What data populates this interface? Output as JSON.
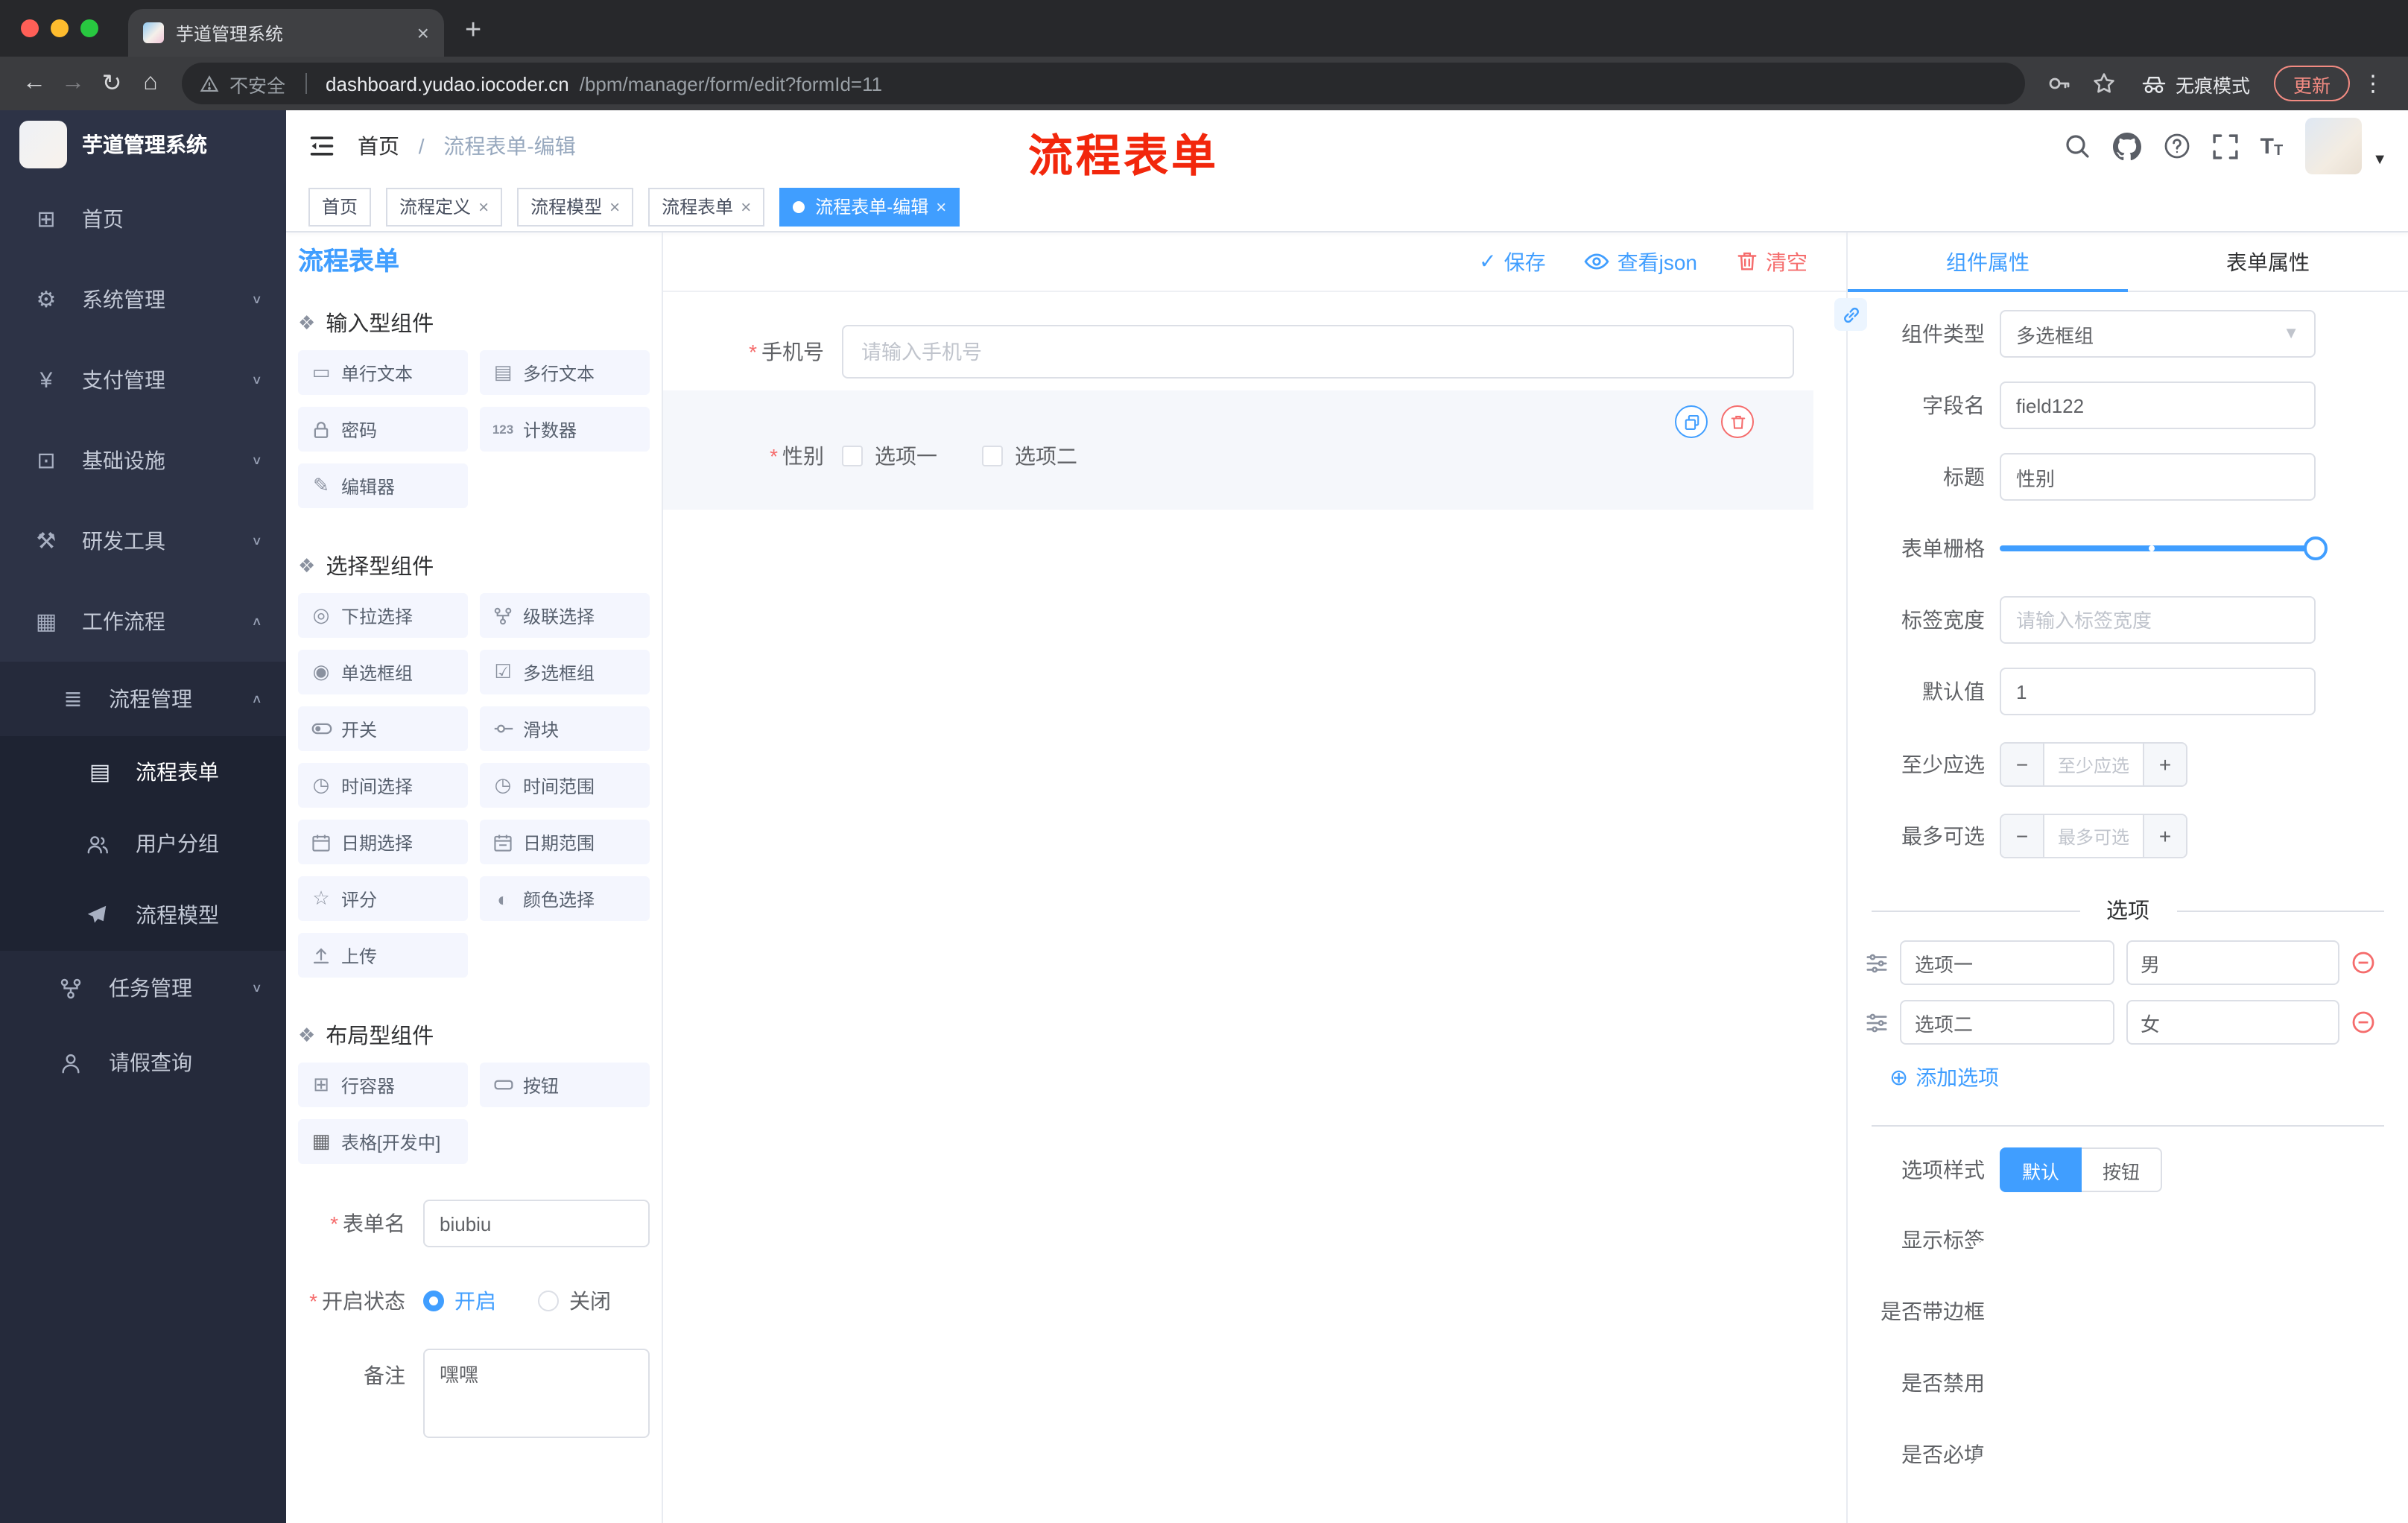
{
  "browser": {
    "tab": {
      "title": "芋道管理系统"
    },
    "address": {
      "security": "不安全",
      "domain": "dashboard.yudao.iocoder.cn",
      "path": "/bpm/manager/form/edit?formId=11",
      "incognito": "无痕模式",
      "update": "更新"
    }
  },
  "sidebar": {
    "logo": "芋道管理系统",
    "items": [
      {
        "label": "首页"
      },
      {
        "label": "系统管理"
      },
      {
        "label": "支付管理"
      },
      {
        "label": "基础设施"
      },
      {
        "label": "研发工具"
      },
      {
        "label": "工作流程"
      },
      {
        "label": "流程管理"
      },
      {
        "label": "流程表单"
      },
      {
        "label": "用户分组"
      },
      {
        "label": "流程模型"
      },
      {
        "label": "任务管理"
      },
      {
        "label": "请假查询"
      }
    ]
  },
  "header": {
    "breadcrumb": {
      "home": "首页",
      "separator": "/",
      "current": "流程表单-编辑"
    },
    "annotation": "流程表单"
  },
  "tags": [
    {
      "label": "首页"
    },
    {
      "label": "流程定义"
    },
    {
      "label": "流程模型"
    },
    {
      "label": "流程表单"
    },
    {
      "label": "流程表单-编辑"
    }
  ],
  "designer": {
    "title": "流程表单",
    "toolbar": {
      "save": "保存",
      "view_json": "查看json",
      "clear": "清空"
    },
    "palette": {
      "sections": [
        {
          "title": "输入型组件",
          "items": [
            "单行文本",
            "多行文本",
            "密码",
            "计数器",
            "编辑器"
          ]
        },
        {
          "title": "选择型组件",
          "items": [
            "下拉选择",
            "级联选择",
            "单选框组",
            "多选框组",
            "开关",
            "滑块",
            "时间选择",
            "时间范围",
            "日期选择",
            "日期范围",
            "评分",
            "颜色选择",
            "上传"
          ]
        },
        {
          "title": "布局型组件",
          "items": [
            "行容器",
            "按钮",
            "表格[开发中]"
          ]
        }
      ]
    },
    "meta_form": {
      "name_label": "表单名",
      "name_value": "biubiu",
      "status_label": "开启状态",
      "status_on": "开启",
      "status_off": "关闭",
      "remark_label": "备注",
      "remark_value": "嘿嘿"
    },
    "canvas": {
      "phone": {
        "label": "手机号",
        "placeholder": "请输入手机号"
      },
      "gender": {
        "label": "性别",
        "options": [
          "选项一",
          "选项二"
        ]
      }
    },
    "props": {
      "tabs": {
        "component": "组件属性",
        "form": "表单属性"
      },
      "component_type": {
        "label": "组件类型",
        "value": "多选框组"
      },
      "field_name": {
        "label": "字段名",
        "value": "field122"
      },
      "title": {
        "label": "标题",
        "value": "性别"
      },
      "grid": {
        "label": "表单栅格"
      },
      "label_width": {
        "label": "标签宽度",
        "placeholder": "请输入标签宽度"
      },
      "default_value": {
        "label": "默认值",
        "value": "1"
      },
      "min_select": {
        "label": "至少应选",
        "placeholder": "至少应选"
      },
      "max_select": {
        "label": "最多可选",
        "placeholder": "最多可选"
      },
      "options_title": "选项",
      "options": [
        {
          "label": "选项一",
          "value": "男"
        },
        {
          "label": "选项二",
          "value": "女"
        }
      ],
      "add_option": "添加选项",
      "option_style": {
        "label": "选项样式",
        "default": "默认",
        "button": "按钮"
      },
      "toggles": [
        {
          "label": "显示标签",
          "on": true
        },
        {
          "label": "是否带边框",
          "on": false
        },
        {
          "label": "是否禁用",
          "on": false
        },
        {
          "label": "是否必填",
          "on": true
        }
      ]
    }
  },
  "colors": {
    "accent": "#409eff",
    "danger": "#f56c6c",
    "annotation": "#f2270c",
    "sidebar_bg": "#2d3346"
  }
}
